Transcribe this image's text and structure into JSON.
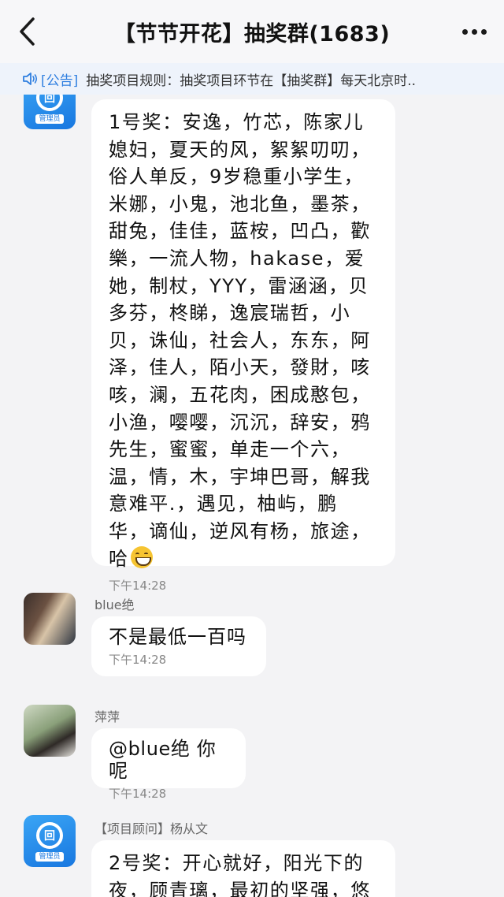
{
  "header": {
    "title": "【节节开花】抽奖群(1683)"
  },
  "notice": {
    "tag": "[公告]",
    "text": "抽奖项目规则：抽奖项目环节在【抽奖群】每天北京时.."
  },
  "admin_badge": "管理员",
  "messages": [
    {
      "sender": "",
      "avatar_icon": "admin-badge-icon",
      "text": "1号奖：安逸，竹芯，陈家儿媳妇，夏天的风，絮絮叨叨，俗人单反，9岁稳重小学生，米娜，小鬼，池北鱼，墨茶，甜兔，佳佳，蓝桉，凹凸，歡樂，一流人物，hakase，爱她，制杖，YYY，雷涵涵，贝多芬，柊睇，逸宸瑞哲，小贝，诛仙，社会人，东东，阿泽，佳人，陌小天，發財，咳咳，澜，五花肉，困成憨包，小渔，嘤嘤，沉沉，辞安，鸦先生，蜜蜜，单走一个六，温，情，木，宇坤巴哥，解我意难平.，遇见，柚屿，鹏华，谪仙，逆风有杨，旅途，哈",
      "emoji": "grinning-face-emoji",
      "time": "下午14:28"
    },
    {
      "sender": "blue绝",
      "avatar_icon": "user-photo",
      "text": "不是最低一百吗",
      "time": "下午14:28"
    },
    {
      "sender": "萍萍",
      "avatar_icon": "user-photo",
      "text": "@blue绝 你呢",
      "time": "下午14:28"
    },
    {
      "sender": "【项目顾问】杨从文",
      "avatar_icon": "admin-badge-icon",
      "text": "2号奖：开心就好，阳光下的夜，顾青璃，最初的坚强，悠",
      "time": ""
    }
  ]
}
